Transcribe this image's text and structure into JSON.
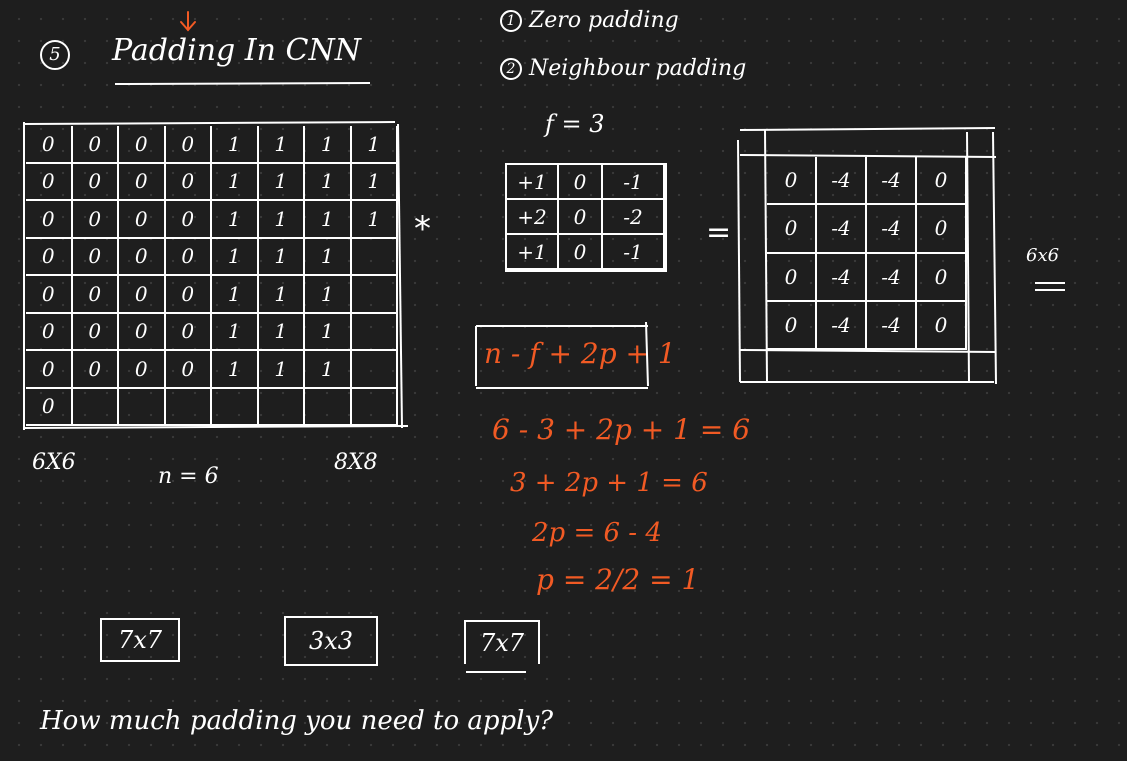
{
  "title": {
    "number": "5",
    "text": "Padding In CNN"
  },
  "options": [
    {
      "number": "1",
      "text": "Zero padding"
    },
    {
      "number": "2",
      "text": "Neighbour padding"
    }
  ],
  "filter_size": "f = 3",
  "input_matrix": {
    "rows": [
      [
        "0",
        "0",
        "0",
        "0",
        "1",
        "1",
        "1",
        "1"
      ],
      [
        "0",
        "0",
        "0",
        "0",
        "1",
        "1",
        "1",
        "1"
      ],
      [
        "0",
        "0",
        "0",
        "0",
        "1",
        "1",
        "1",
        "1"
      ],
      [
        "0",
        "0",
        "0",
        "0",
        "1",
        "1",
        "1",
        ""
      ],
      [
        "0",
        "0",
        "0",
        "0",
        "1",
        "1",
        "1",
        ""
      ],
      [
        "0",
        "0",
        "0",
        "0",
        "1",
        "1",
        "1",
        ""
      ],
      [
        "0",
        "0",
        "0",
        "0",
        "1",
        "1",
        "1",
        ""
      ],
      [
        "0",
        "",
        "",
        "",
        "",
        "",
        "",
        ""
      ]
    ],
    "label_size": "6X6",
    "label_n": "n = 6",
    "label_padded": "8X8"
  },
  "operator": "*",
  "filter_matrix": {
    "rows": [
      [
        "+1",
        "0",
        "-1"
      ],
      [
        "+2",
        "0",
        "-2"
      ],
      [
        "+1",
        "0",
        "-1"
      ]
    ]
  },
  "equals": "=",
  "output_matrix": {
    "rows": [
      [
        "0",
        "-4",
        "-4",
        "0"
      ],
      [
        "0",
        "-4",
        "-4",
        "0"
      ],
      [
        "0",
        "-4",
        "-4",
        "0"
      ],
      [
        "0",
        "-4",
        "-4",
        "0"
      ]
    ],
    "label": "6x6"
  },
  "formula": "n - f + 2p + 1",
  "derivation": [
    "6 - 3 + 2p + 1 = 6",
    "3 + 2p + 1 = 6",
    "2p = 6 - 4",
    "p = 2/2 = 1"
  ],
  "boxes": [
    "7x7",
    "3x3",
    "7x7"
  ],
  "question": "How much padding you need to apply?"
}
